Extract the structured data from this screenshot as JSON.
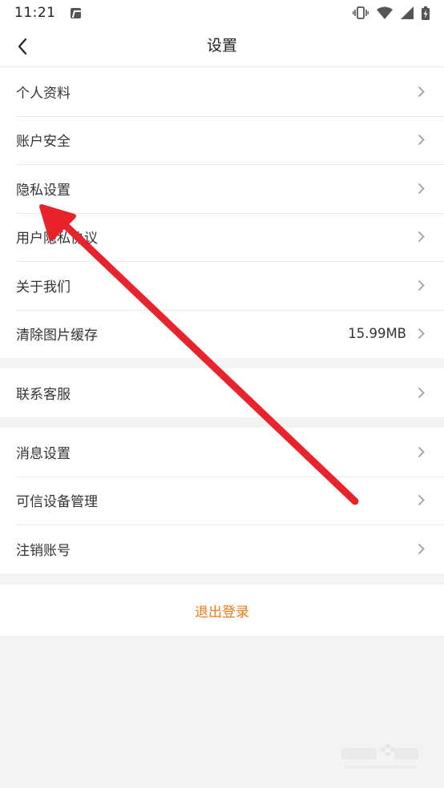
{
  "status_bar": {
    "time": "11:21",
    "icons": [
      "app-notification-icon",
      "vibrate-icon",
      "wifi-icon",
      "signal-icon",
      "battery-charging-icon"
    ]
  },
  "nav": {
    "title": "设置",
    "back_icon": "chevron-left-icon"
  },
  "groups": [
    {
      "items": [
        {
          "label": "个人资料"
        },
        {
          "label": "账户安全"
        },
        {
          "label": "隐私设置"
        },
        {
          "label": "用户隐私协议"
        },
        {
          "label": "关于我们"
        },
        {
          "label": "清除图片缓存",
          "value": "15.99MB"
        }
      ]
    },
    {
      "items": [
        {
          "label": "联系客服"
        }
      ]
    },
    {
      "items": [
        {
          "label": "消息设置"
        },
        {
          "label": "可信设备管理"
        },
        {
          "label": "注销账号"
        }
      ]
    }
  ],
  "logout": {
    "label": "退出登录",
    "color": "#f07a14"
  },
  "annotation": {
    "arrow_color": "#e8232c"
  },
  "colors": {
    "background": "#f3f3f3",
    "surface": "#ffffff",
    "chevron": "#9a9a9a"
  }
}
